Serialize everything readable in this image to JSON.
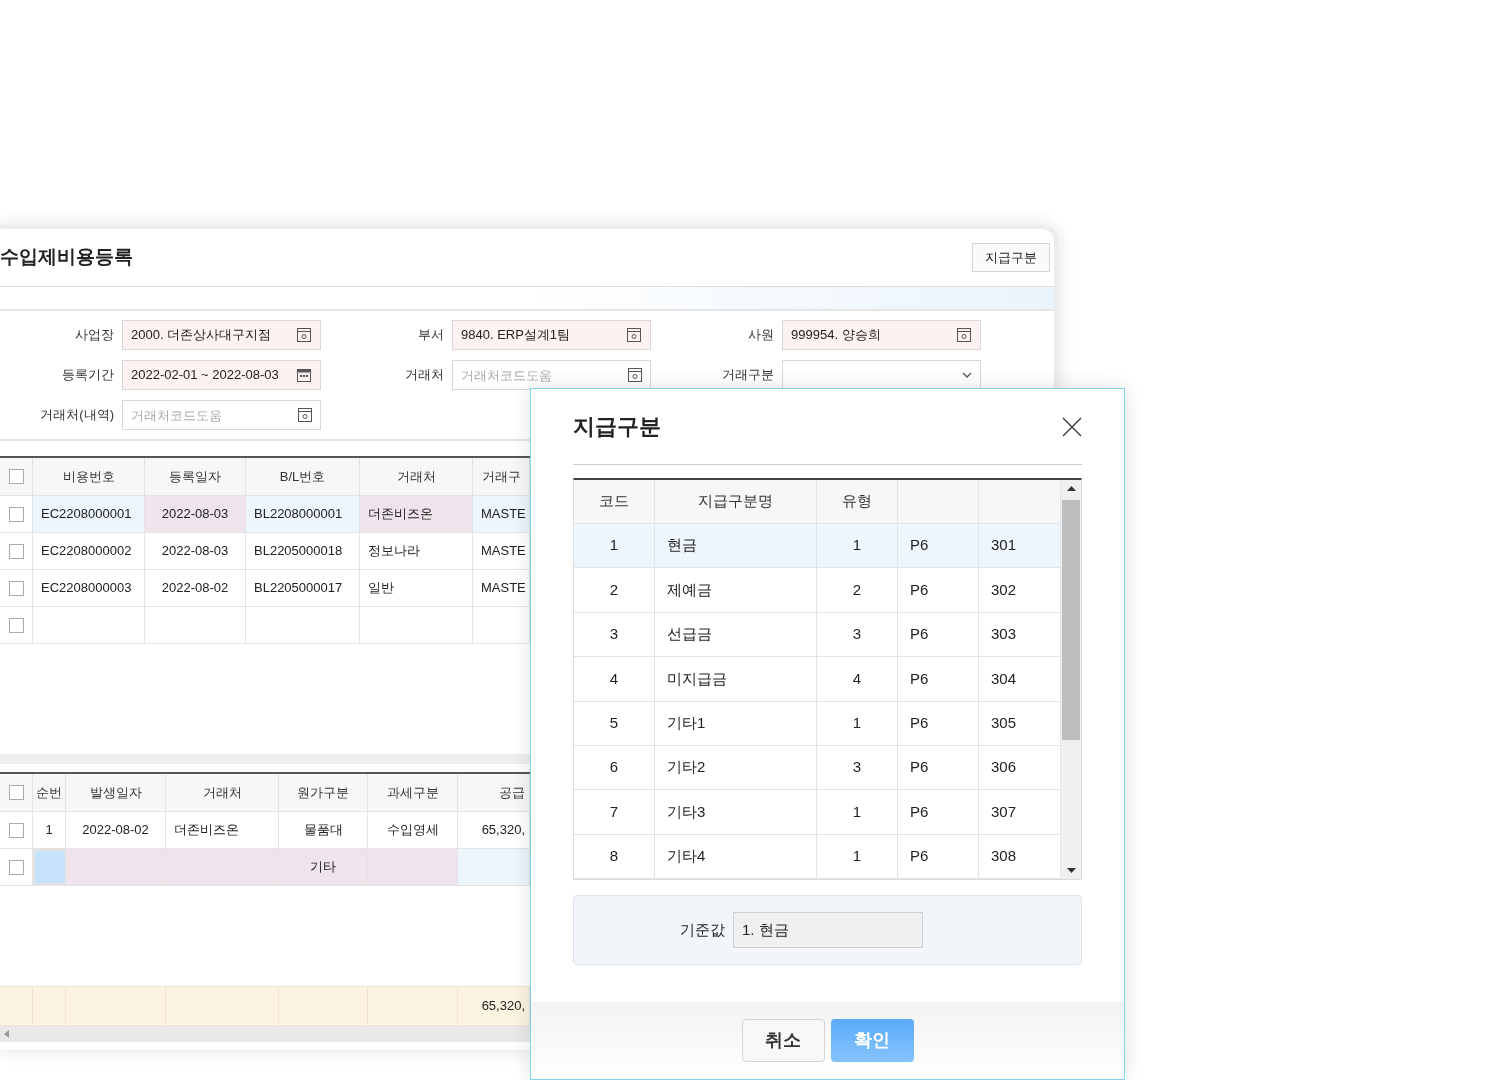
{
  "window": {
    "title": "수입제비용등록",
    "toolbar_button": "지급구분"
  },
  "form": {
    "rows": [
      {
        "fields": [
          {
            "label": "사업장",
            "kind": "lookup",
            "required": true,
            "value": "2000. 더존상사대구지점"
          },
          {
            "label": "부서",
            "kind": "lookup",
            "required": true,
            "value": "9840. ERP설계1팀"
          },
          {
            "label": "사원",
            "kind": "lookup",
            "required": true,
            "value": "999954. 양승희"
          }
        ]
      },
      {
        "fields": [
          {
            "label": "등록기간",
            "kind": "date",
            "required": true,
            "value": "2022-02-01 ~ 2022-08-03"
          },
          {
            "label": "거래처",
            "kind": "lookup",
            "required": false,
            "placeholder": "거래처코드도움"
          },
          {
            "label": "거래구분",
            "kind": "select",
            "required": false
          }
        ]
      },
      {
        "fields": [
          {
            "label": "거래처(내역)",
            "kind": "lookup",
            "required": false,
            "placeholder": "거래처코드도움"
          }
        ]
      }
    ]
  },
  "cost_grid": {
    "header_checked": false,
    "columns": [
      "비용번호",
      "등록일자",
      "B/L번호",
      "거래처",
      "거래구"
    ],
    "rows": [
      {
        "checked": false,
        "selected": true,
        "cells": [
          "EC2208000001",
          "2022-08-03",
          "BL2208000001",
          "더존비즈온",
          "MASTE"
        ]
      },
      {
        "checked": false,
        "selected": false,
        "cells": [
          "EC2208000002",
          "2022-08-03",
          "BL2205000018",
          "정보나라",
          "MASTE"
        ]
      },
      {
        "checked": false,
        "selected": false,
        "cells": [
          "EC2208000003",
          "2022-08-02",
          "BL2205000017",
          "일반",
          "MASTE"
        ]
      },
      {
        "checked": false,
        "selected": false
      }
    ]
  },
  "detail_grid": {
    "header_checked": false,
    "columns": [
      "순번",
      "발생일자",
      "거래처",
      "원가구분",
      "과세구분",
      "공급"
    ],
    "rows": [
      {
        "checked": false,
        "selected": false,
        "cells": [
          {
            "text": "1"
          },
          {
            "text": "2022-08-02"
          },
          {
            "text": "더존비즈온"
          },
          {
            "text": "물품대"
          },
          {
            "text": "수입영세"
          },
          {
            "text": "65,320,"
          }
        ]
      },
      {
        "checked": false,
        "selected": true,
        "cells": [
          {
            "active": true
          },
          {},
          {},
          {
            "text": "기타"
          },
          {},
          {}
        ]
      }
    ],
    "footer": {
      "total": "65,320,"
    }
  },
  "dialog": {
    "title": "지급구분",
    "columns": [
      "코드",
      "지급구분명",
      "유형"
    ],
    "rows": [
      {
        "selected": true,
        "cells": [
          "1",
          "현금",
          "1",
          "P6",
          "301"
        ]
      },
      {
        "selected": false,
        "cells": [
          "2",
          "제예금",
          "2",
          "P6",
          "302"
        ]
      },
      {
        "selected": false,
        "cells": [
          "3",
          "선급금",
          "3",
          "P6",
          "303"
        ]
      },
      {
        "selected": false,
        "cells": [
          "4",
          "미지급금",
          "4",
          "P6",
          "304"
        ]
      },
      {
        "selected": false,
        "cells": [
          "5",
          "기타1",
          "1",
          "P6",
          "305"
        ]
      },
      {
        "selected": false,
        "cells": [
          "6",
          "기타2",
          "3",
          "P6",
          "306"
        ]
      },
      {
        "selected": false,
        "cells": [
          "7",
          "기타3",
          "1",
          "P6",
          "307"
        ]
      },
      {
        "selected": false,
        "cells": [
          "8",
          "기타4",
          "1",
          "P6",
          "308"
        ]
      }
    ],
    "base_value": {
      "label": "기준값",
      "value": "1. 현금"
    },
    "buttons": [
      {
        "label": "취소",
        "kind": "secondary"
      },
      {
        "label": "확인",
        "kind": "primary"
      }
    ]
  }
}
